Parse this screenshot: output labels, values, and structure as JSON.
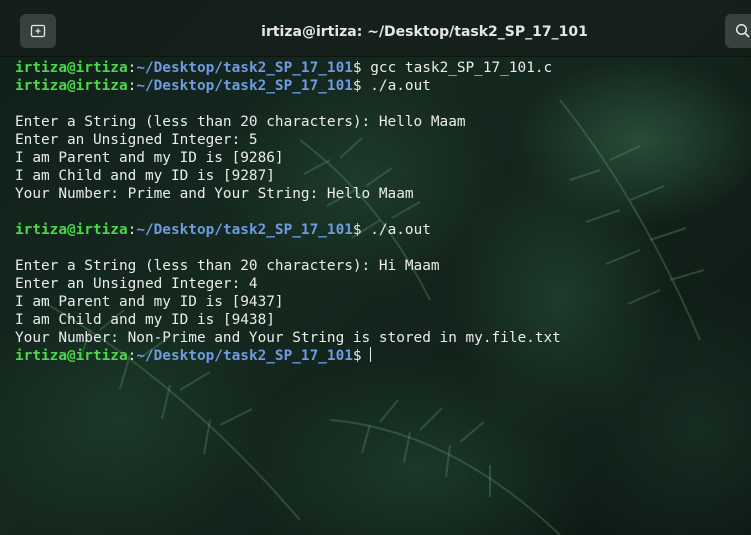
{
  "window": {
    "title": "irtiza@irtiza: ~/Desktop/task2_SP_17_101"
  },
  "icons": {
    "new_tab": "new-tab-icon",
    "search": "search-icon"
  },
  "colors": {
    "user_host": "#4cd84a",
    "path": "#6f9be0",
    "text": "#ececec"
  },
  "terminal": {
    "user_host": "irtiza@irtiza",
    "colon": ":",
    "path": "~/Desktop/task2_SP_17_101",
    "prompt_symbol": "$",
    "lines": [
      {
        "type": "prompt",
        "command": " gcc task2_SP_17_101.c"
      },
      {
        "type": "prompt",
        "command": " ./a.out"
      },
      {
        "type": "output",
        "text": ""
      },
      {
        "type": "output",
        "text": "Enter a String (less than 20 characters): Hello Maam"
      },
      {
        "type": "output",
        "text": "Enter an Unsigned Integer: 5"
      },
      {
        "type": "output",
        "text": "I am Parent and my ID is [9286]"
      },
      {
        "type": "output",
        "text": "I am Child and my ID is [9287]"
      },
      {
        "type": "output",
        "text": "Your Number: Prime and Your String: Hello Maam"
      },
      {
        "type": "output",
        "text": ""
      },
      {
        "type": "prompt",
        "command": " ./a.out"
      },
      {
        "type": "output",
        "text": ""
      },
      {
        "type": "output",
        "text": "Enter a String (less than 20 characters): Hi Maam"
      },
      {
        "type": "output",
        "text": "Enter an Unsigned Integer: 4"
      },
      {
        "type": "output",
        "text": "I am Parent and my ID is [9437]"
      },
      {
        "type": "output",
        "text": "I am Child and my ID is [9438]"
      },
      {
        "type": "output",
        "text": "Your Number: Non-Prime and Your String is stored in my.file.txt"
      },
      {
        "type": "prompt",
        "command": " ",
        "cursor": true
      }
    ]
  }
}
